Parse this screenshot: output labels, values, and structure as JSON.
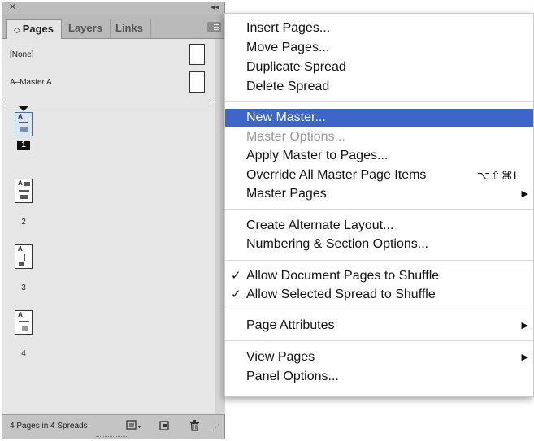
{
  "panel": {
    "tabs": [
      {
        "label": "Pages",
        "prefix": "◇"
      },
      {
        "label": "Layers"
      },
      {
        "label": "Links"
      }
    ],
    "masters": [
      {
        "label": "[None]"
      },
      {
        "label": "A–Master A"
      }
    ],
    "pages": [
      {
        "number": "1",
        "master": "A"
      },
      {
        "number": "2",
        "master": "A"
      },
      {
        "number": "3",
        "master": "A"
      },
      {
        "number": "4",
        "master": "A"
      }
    ],
    "footer_status": "4 Pages in 4 Spreads"
  },
  "menu": {
    "items": [
      {
        "label": "Insert Pages..."
      },
      {
        "label": "Move Pages..."
      },
      {
        "label": "Duplicate Spread"
      },
      {
        "label": "Delete Spread"
      },
      {
        "label": "New Master..."
      },
      {
        "label": "Master Options..."
      },
      {
        "label": "Apply Master to Pages..."
      },
      {
        "label": "Override All Master Page Items",
        "shortcut": "⌥⇧⌘L"
      },
      {
        "label": "Master Pages"
      },
      {
        "label": "Create Alternate Layout..."
      },
      {
        "label": "Numbering & Section Options..."
      },
      {
        "label": "Allow Document Pages to Shuffle",
        "checked": "✓"
      },
      {
        "label": "Allow Selected Spread to Shuffle",
        "checked": "✓"
      },
      {
        "label": "Page Attributes"
      },
      {
        "label": "View Pages"
      },
      {
        "label": "Panel Options..."
      }
    ]
  },
  "colors": {
    "highlight": "#3d66c8",
    "panel_bg": "#e6e6e6",
    "disabled_text": "#9a9a9a"
  },
  "icons": [
    "close-icon",
    "collapse-icon",
    "panel-menu-icon",
    "page-size-icon",
    "new-page-icon",
    "trash-icon",
    "submenu-arrow-icon",
    "checkmark-icon"
  ]
}
